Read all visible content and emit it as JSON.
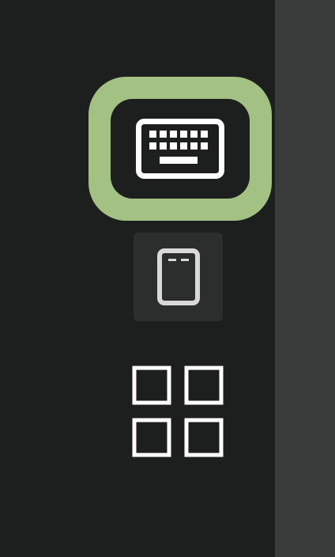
{
  "toolbar": {
    "items": [
      {
        "id": "keyboard",
        "icon": "keyboard-icon",
        "selected": true
      },
      {
        "id": "device",
        "icon": "device-icon",
        "selected": false
      },
      {
        "id": "apps",
        "icon": "grid-icon",
        "selected": false
      }
    ]
  },
  "colors": {
    "background": "#1d1f1e",
    "right_panel": "#3a3b3b",
    "highlight": "#a3c183",
    "button_bg": "#2c2e2d",
    "icon": "#ffffff"
  }
}
